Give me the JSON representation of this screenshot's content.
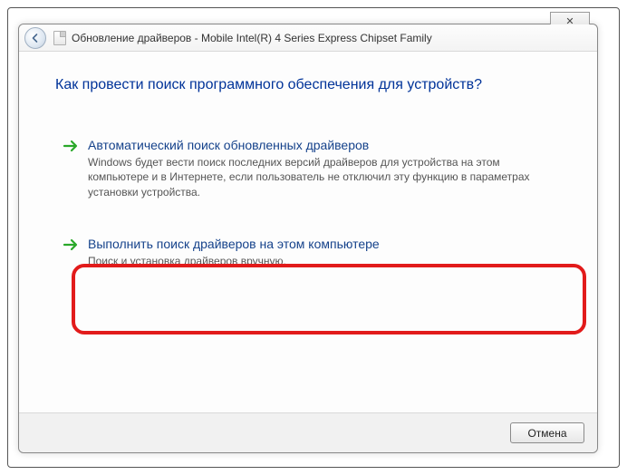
{
  "title": "Обновление драйверов - Mobile Intel(R) 4 Series Express Chipset Family",
  "heading": "Как провести поиск программного обеспечения для устройств?",
  "options": [
    {
      "title": "Автоматический поиск обновленных драйверов",
      "desc": "Windows будет вести поиск последних версий драйверов для устройства на этом компьютере и в Интернете, если пользователь не отключил эту функцию в параметрах установки устройства."
    },
    {
      "title": "Выполнить поиск драйверов на этом компьютере",
      "desc": "Поиск и установка драйверов вручную."
    }
  ],
  "footer": {
    "cancel": "Отмена"
  },
  "close_glyph": "✕"
}
